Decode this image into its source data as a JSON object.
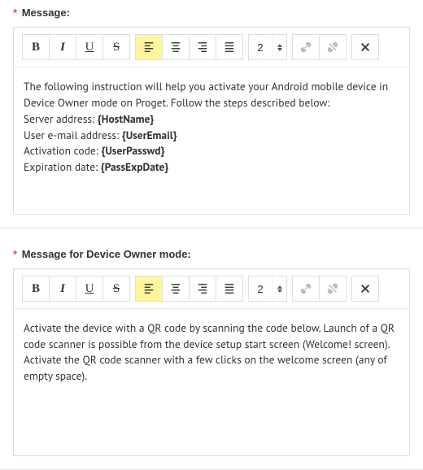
{
  "fields": [
    {
      "label": "Message:",
      "required": true,
      "editor": {
        "size": "2",
        "intro": "The following instruction will help you activate your Android mobile device in Device Owner mode on Proget. Follow the steps described below:",
        "pairs": [
          {
            "label": "Server address: ",
            "value": "{HostName}"
          },
          {
            "label": "User e-mail address: ",
            "value": "{UserEmail}"
          },
          {
            "label": "Activation code: ",
            "value": "{UserPasswd}"
          },
          {
            "label": "Expiration date: ",
            "value": "{PassExpDate}"
          }
        ]
      }
    },
    {
      "label": "Message for Device Owner mode:",
      "required": true,
      "editor": {
        "size": "2",
        "intro": "Activate the device with a QR code by scanning the code below. Launch of a QR code scanner is possible from the device setup start screen (Welcome! screen). Activate the QR code scanner with a few clicks on the welcome screen (any of empty space).",
        "pairs": []
      }
    }
  ],
  "toolbar": {
    "bold": "B",
    "italic": "I",
    "underline": "U",
    "strike": "S"
  }
}
